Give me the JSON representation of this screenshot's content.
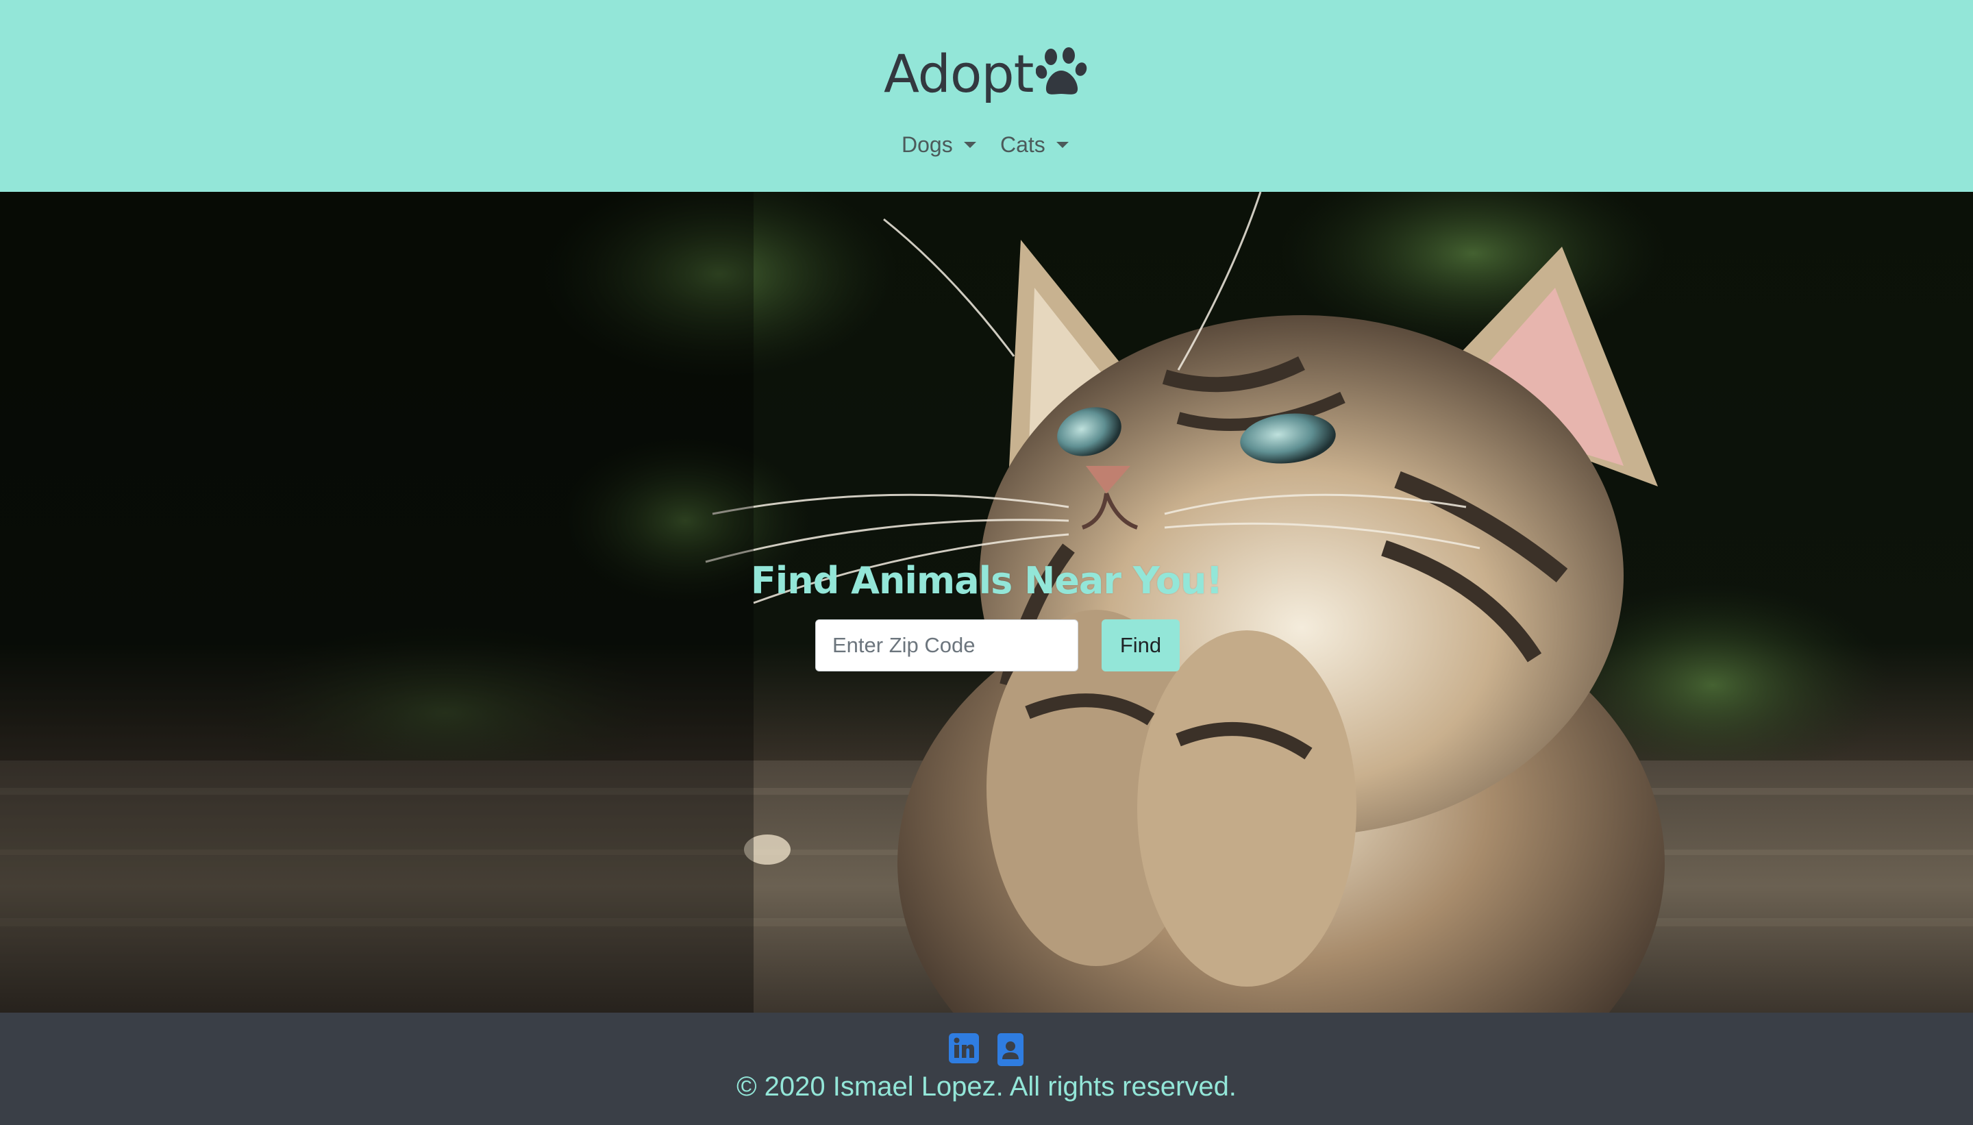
{
  "brand": {
    "name": "Adopt",
    "icon": "paw-icon"
  },
  "nav": {
    "items": [
      {
        "label": "Dogs",
        "icon": "caret-down-icon"
      },
      {
        "label": "Cats",
        "icon": "caret-down-icon"
      }
    ]
  },
  "hero": {
    "title": "Find Animals Near You!",
    "image": "kitten-photo",
    "search": {
      "placeholder": "Enter Zip Code",
      "value": "",
      "button_label": "Find"
    }
  },
  "footer": {
    "social": [
      {
        "icon": "linkedin-icon"
      },
      {
        "icon": "contact-card-icon"
      }
    ],
    "copyright": "© 2020 Ismael Lopez. All rights reserved."
  },
  "colors": {
    "accent": "#93e6d8",
    "header_bg": "#93e6d8",
    "footer_bg": "#3a3f47",
    "brand_text": "#33383f",
    "social_icon": "#2f7de1"
  }
}
